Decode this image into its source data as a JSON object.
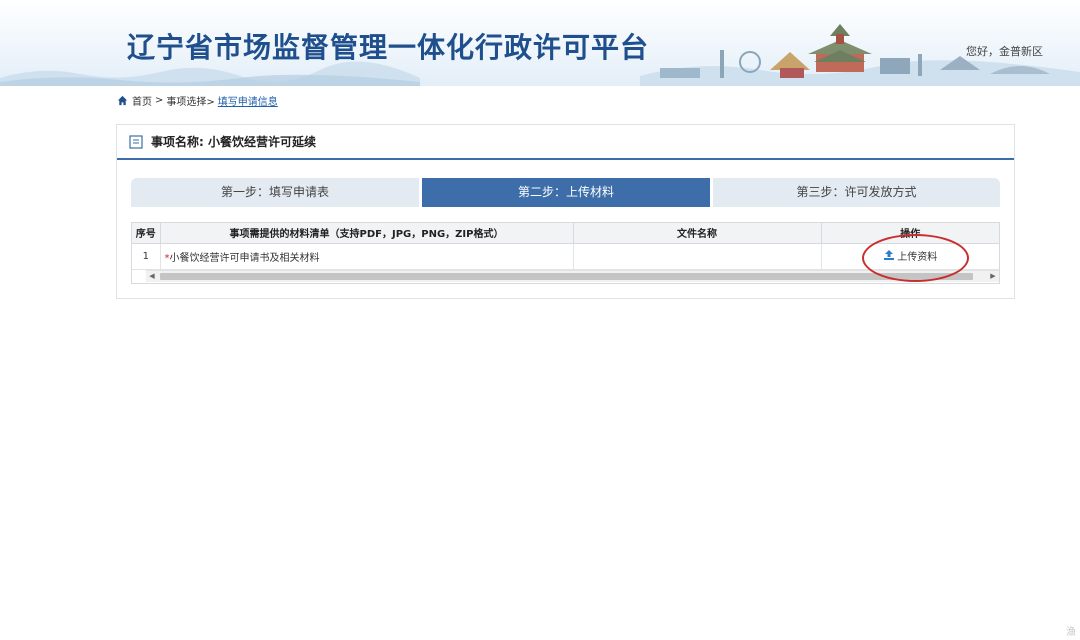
{
  "header": {
    "title": "辽宁省市场监督管理一体化行政许可平台",
    "greeting": "您好，金普新区"
  },
  "breadcrumb": {
    "home": "首页",
    "sep1": ">",
    "step1": "事项选择>",
    "current": "填写申请信息"
  },
  "panel": {
    "item_label": "事项名称: 小餐饮经营许可延续"
  },
  "steps": [
    {
      "label": "第一步：填写申请表",
      "active": false
    },
    {
      "label": "第二步：上传材料",
      "active": true
    },
    {
      "label": "第三步：许可发放方式",
      "active": false
    }
  ],
  "table": {
    "headers": {
      "index": "序号",
      "materials": "事项需提供的材料清单（支持PDF，JPG，PNG，ZIP格式）",
      "filename": "文件名称",
      "action": "操作"
    },
    "rows": [
      {
        "index": "1",
        "required_mark": "*",
        "material": "小餐饮经营许可申请书及相关材料",
        "filename": "",
        "action": "上传资料"
      }
    ]
  },
  "colors": {
    "brand_blue": "#3d6ea9",
    "title_blue": "#1f4f8c",
    "highlight_red": "#c92d2d"
  },
  "icons": [
    "home-icon",
    "document-icon",
    "upload-icon"
  ],
  "corner_mark": "渔"
}
